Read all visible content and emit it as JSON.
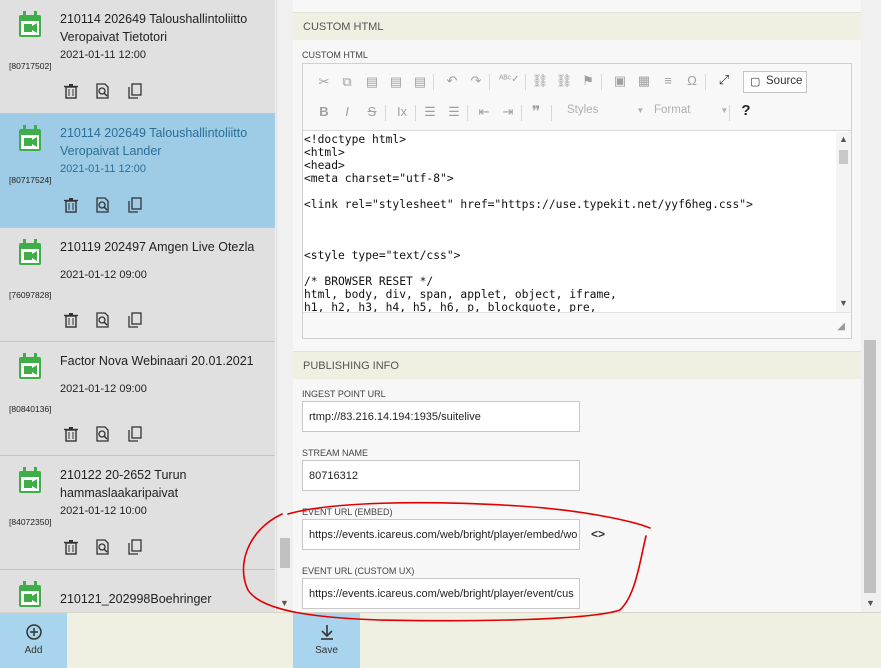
{
  "events": [
    {
      "title": "210114 202649 Taloushallintoliitto Veropaivat Tietotori",
      "date": "2021-01-11 12:00",
      "code": "[80717502]",
      "selected": false
    },
    {
      "title": "210114 202649 Taloushallintoliitto Veropaivat Lander",
      "date": "2021-01-11 12:00",
      "code": "[80717524]",
      "selected": true
    },
    {
      "title": "210119 202497 Amgen Live Otezla",
      "date": "2021-01-12 09:00",
      "code": "[76097828]",
      "selected": false
    },
    {
      "title": "Factor Nova Webinaari 20.01.2021",
      "date": "2021-01-12 09:00",
      "code": "[80840136]",
      "selected": false
    },
    {
      "title": "210122 20-2652 Turun hammaslaakaripaivat",
      "date": "2021-01-12 10:00",
      "code": "[84072350]",
      "selected": false
    },
    {
      "title": "210121_202998Boehringer",
      "date": "",
      "code": "",
      "selected": false
    }
  ],
  "custom_html": {
    "section_title": "CUSTOM HTML",
    "field_label": "CUSTOM HTML",
    "source_button": "Source",
    "styles_combo": "Styles",
    "format_combo": "Format",
    "code_lines": [
      "<!doctype html>",
      "<html>",
      "<head>",
      "<meta charset=\"utf-8\">",
      "",
      "<link rel=\"stylesheet\" href=\"https://use.typekit.net/yyf6heg.css\">",
      "",
      "",
      "",
      "<style type=\"text/css\">",
      "",
      "/* BROWSER RESET */",
      "html, body, div, span, applet, object, iframe,",
      "h1, h2, h3, h4, h5, h6, p, blockquote, pre,"
    ]
  },
  "publishing": {
    "section_title": "PUBLISHING INFO",
    "ingest_label": "INGEST POINT URL",
    "ingest_value": "rtmp://83.216.14.194:1935/suitelive",
    "stream_label": "STREAM NAME",
    "stream_value": "80716312",
    "embed_label": "EVENT URL (EMBED)",
    "embed_value": "https://events.icareus.com/web/bright/player/embed/wo",
    "custom_label": "EVENT URL (CUSTOM UX)",
    "custom_value": "https://events.icareus.com/web/bright/player/event/cus"
  },
  "bottom_bar": {
    "add_label": "Add",
    "save_label": "Save"
  },
  "colors": {
    "selected_row": "#9ecce6",
    "calendar_icon": "#3fae49",
    "annotation": "#e00000",
    "button_bg": "#a8d4ee"
  }
}
